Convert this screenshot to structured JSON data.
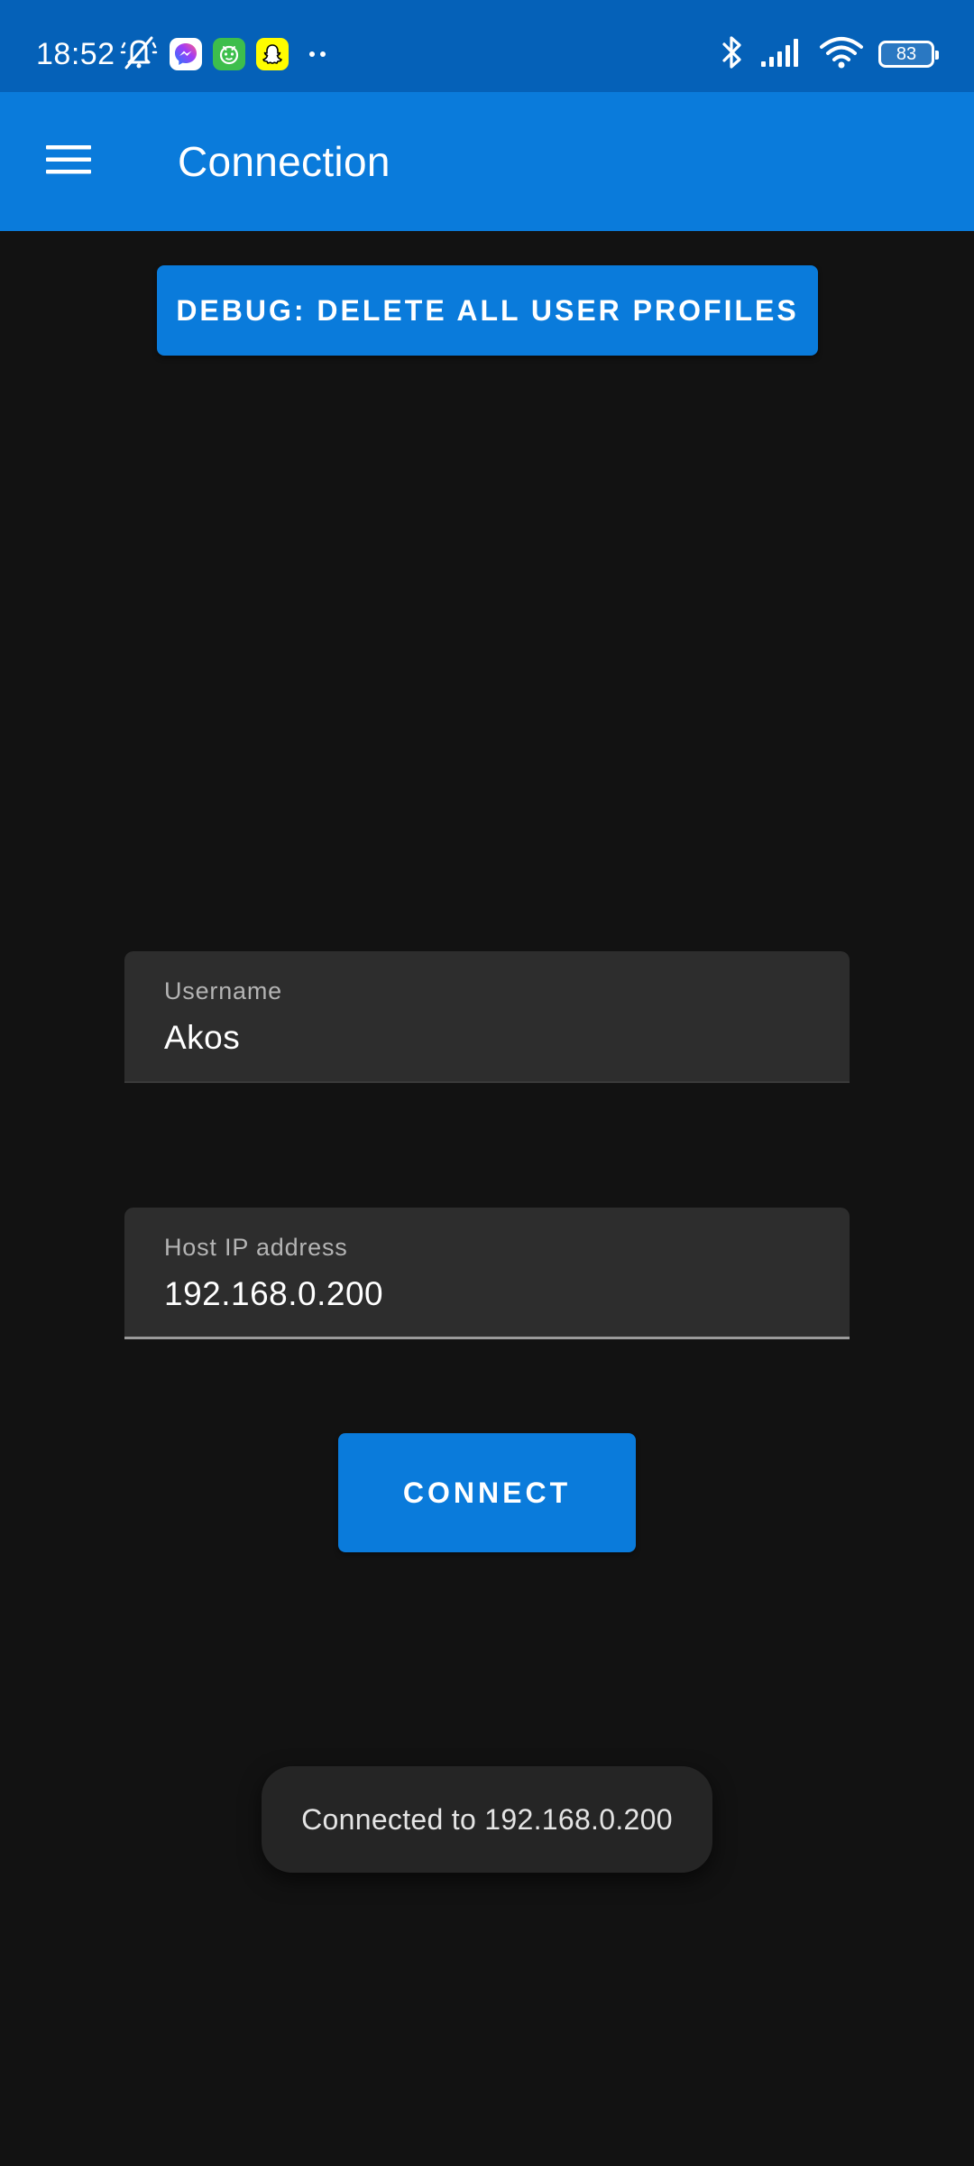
{
  "status_bar": {
    "time": "18:52",
    "battery_level": "83",
    "icons": [
      "mute-icon",
      "messenger-icon",
      "android-app-icon",
      "snapchat-icon",
      "more-dots-icon",
      "bluetooth-icon",
      "signal-icon",
      "wifi-icon",
      "battery-icon"
    ],
    "colors": {
      "background": "#0561B8",
      "messenger": "#8A3CF5",
      "android_app": "#3DBE4C",
      "snapchat": "#FFFC00"
    }
  },
  "app_bar": {
    "title": "Connection",
    "menu_icon": "hamburger-menu-icon",
    "color": "#0A7BDB"
  },
  "debug_button": {
    "label": "DEBUG: DELETE ALL USER PROFILES"
  },
  "form": {
    "username": {
      "label": "Username",
      "value": "Akos"
    },
    "host": {
      "label": "Host IP address",
      "value": "192.168.0.200"
    }
  },
  "connect_button": {
    "label": "CONNECT"
  },
  "toast": {
    "message": "Connected to 192.168.0.200"
  },
  "theme": {
    "background": "#121212",
    "field_background": "#2D2D2D",
    "accent": "#0A7BDB"
  }
}
